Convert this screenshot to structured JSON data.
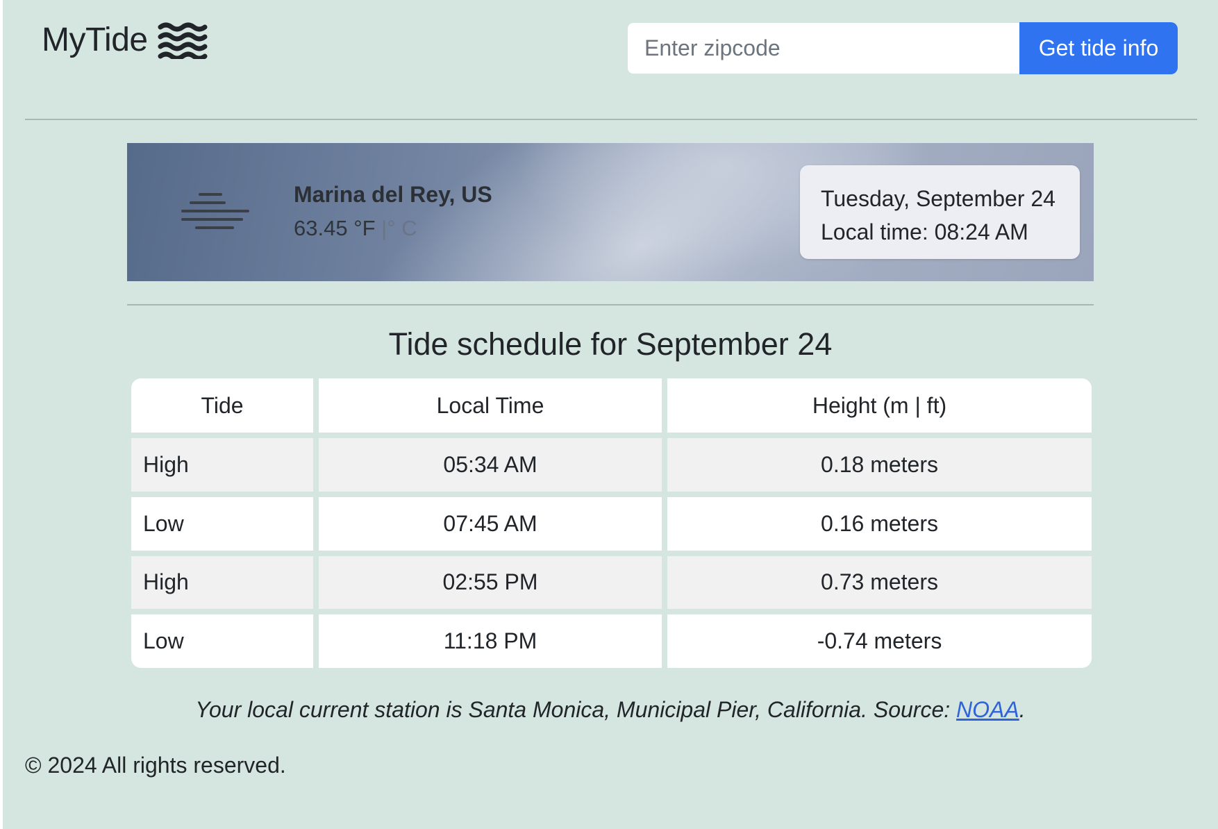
{
  "header": {
    "brand": "MyTide",
    "brand_icon": "waves-icon",
    "search_placeholder": "Enter zipcode",
    "search_value": "",
    "submit_label": "Get tide info",
    "accent_color": "#2f73f0"
  },
  "banner": {
    "weather_icon": "fog-icon",
    "location": "Marina del Rey, US",
    "temp_f": "63.45 °F",
    "temp_sep": "|° C",
    "date": "Tuesday, September 24",
    "local_time": "Local time: 08:24 AM"
  },
  "schedule": {
    "heading": "Tide schedule for September 24",
    "columns": [
      "Tide",
      "Local Time",
      "Height (m | ft)"
    ],
    "rows": [
      {
        "tide": "High",
        "time": "05:34 AM",
        "height": "0.18 meters"
      },
      {
        "tide": "Low",
        "time": "07:45 AM",
        "height": "0.16 meters"
      },
      {
        "tide": "High",
        "time": "02:55 PM",
        "height": "0.73 meters"
      },
      {
        "tide": "Low",
        "time": "11:18 PM",
        "height": "-0.74 meters"
      }
    ]
  },
  "station": {
    "text": "Your local current station is Santa Monica, Municipal Pier, California. Source: ",
    "link_label": "NOAA",
    "suffix": "."
  },
  "footer": {
    "copyright": "© 2024 All rights reserved."
  }
}
